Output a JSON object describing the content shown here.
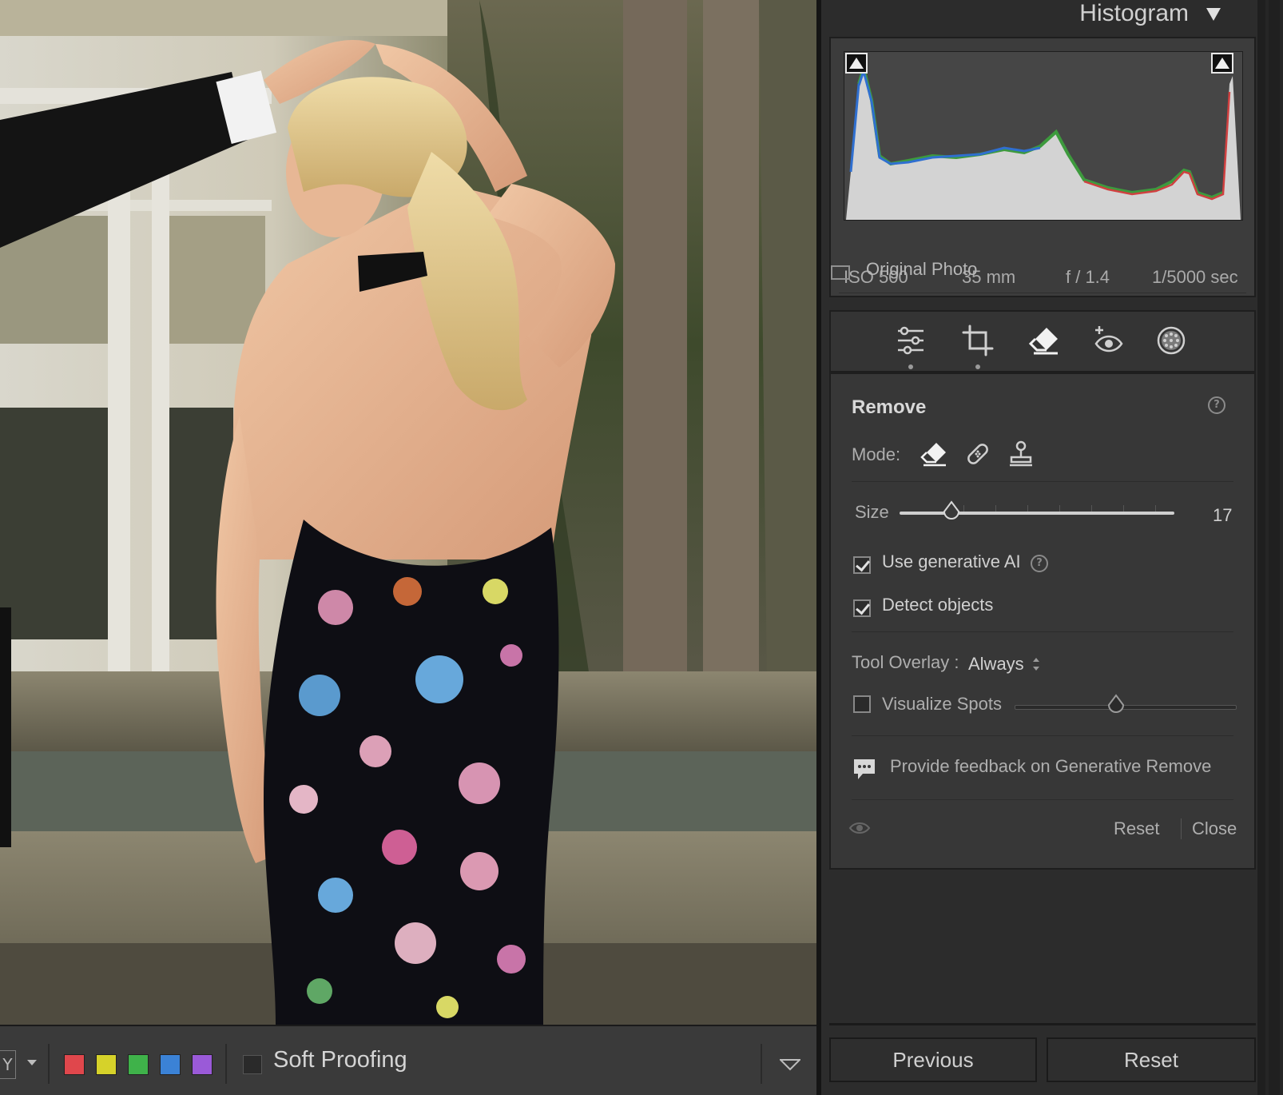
{
  "histogram": {
    "title": "Histogram",
    "iso": "ISO 500",
    "focal_length": "35 mm",
    "aperture": "f / 1.4",
    "shutter": "1/5000 sec",
    "original_photo_label": "Original Photo",
    "original_photo_checked": false
  },
  "tools": [
    {
      "name": "edit",
      "icon": "sliders-icon",
      "has_dot": true
    },
    {
      "name": "crop",
      "icon": "crop-icon",
      "has_dot": true
    },
    {
      "name": "remove",
      "icon": "eraser-icon",
      "active": true
    },
    {
      "name": "red-eye",
      "icon": "red-eye-icon"
    },
    {
      "name": "masking",
      "icon": "masking-icon"
    }
  ],
  "remove": {
    "title": "Remove",
    "mode_label": "Mode:",
    "modes": [
      "eraser-icon",
      "bandage-icon",
      "clone-stamp-icon"
    ],
    "size_label": "Size",
    "size_value": "17",
    "size_level": 0.19,
    "use_gen_ai_label": "Use generative AI",
    "use_gen_ai_checked": true,
    "detect_objects_label": "Detect objects",
    "detect_objects_checked": true,
    "tool_overlay_label": "Tool Overlay :",
    "tool_overlay_value": "Always",
    "visualize_spots_label": "Visualize Spots",
    "visualize_spots_checked": false,
    "visualize_level": 0.46,
    "feedback_label": "Provide feedback on Generative Remove",
    "reset_label": "Reset",
    "close_label": "Close"
  },
  "footer": {
    "previous_label": "Previous",
    "reset_label": "Reset"
  },
  "toolbar": {
    "y_label": "Y",
    "color_labels": [
      "#e0474c",
      "#d6d22a",
      "#3fb24a",
      "#3b82d6",
      "#9a5ad8"
    ],
    "soft_proofing_label": "Soft Proofing"
  }
}
